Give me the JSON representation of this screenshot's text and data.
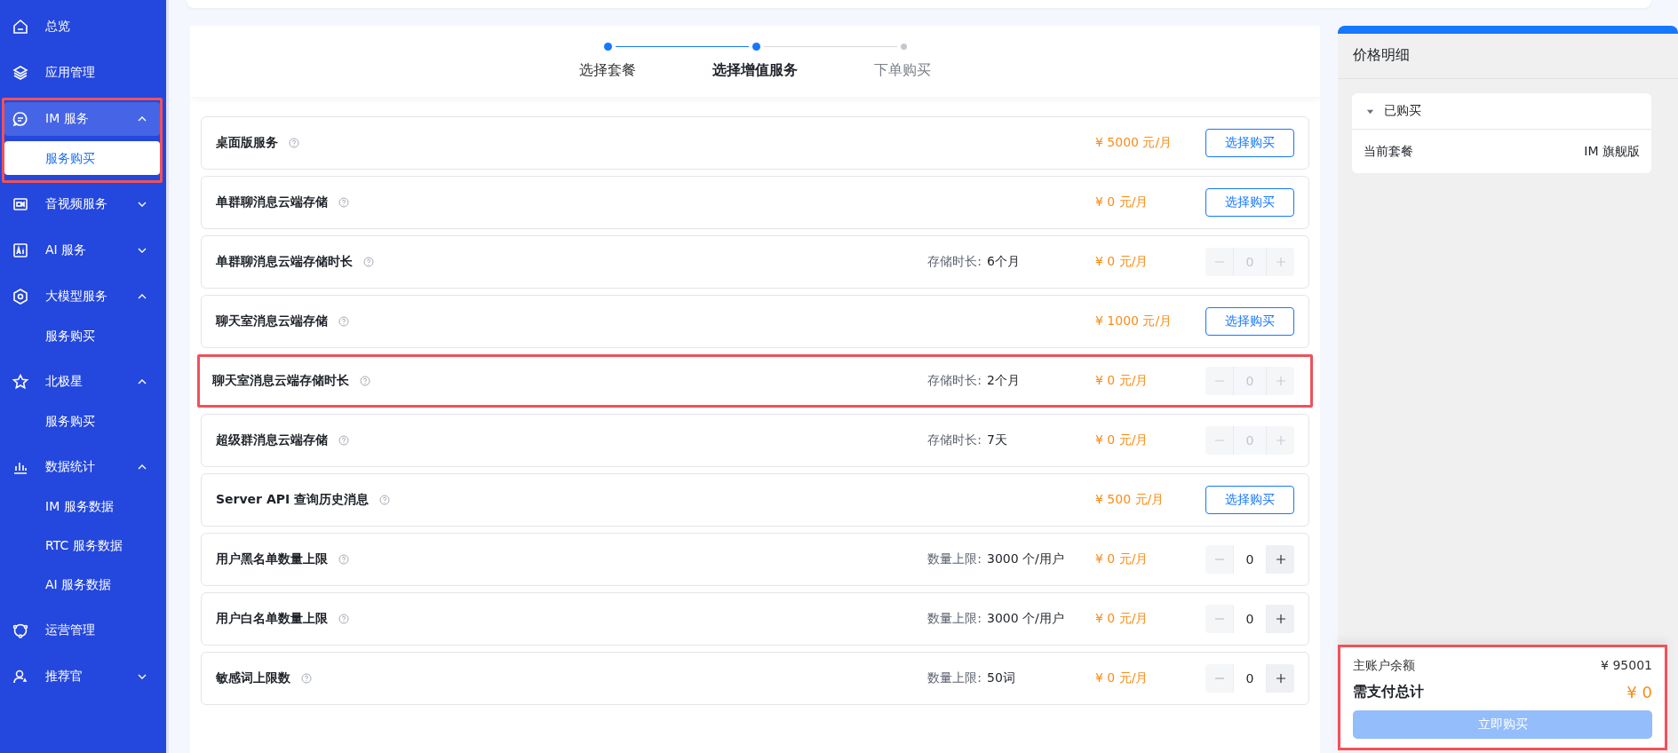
{
  "sidebar": {
    "items": [
      {
        "label": "总览",
        "selected": false,
        "highlighted": false
      },
      {
        "label": "应用管理",
        "selected": false,
        "highlighted": false
      },
      {
        "label": "IM 服务",
        "expanded": true,
        "selected": true,
        "highlighted": true,
        "children": [
          {
            "label": "服务购买",
            "selected": true
          }
        ]
      },
      {
        "label": "音视频服务",
        "expanded": false,
        "selected": false,
        "highlighted": false
      },
      {
        "label": "AI 服务",
        "expanded": false,
        "selected": false,
        "highlighted": false
      },
      {
        "label": "大模型服务",
        "expanded": true,
        "selected": false,
        "highlighted": false,
        "children": [
          {
            "label": "服务购买",
            "selected": false
          }
        ]
      },
      {
        "label": "北极星",
        "expanded": true,
        "selected": false,
        "highlighted": false,
        "children": [
          {
            "label": "服务购买",
            "selected": false
          }
        ]
      },
      {
        "label": "数据统计",
        "expanded": true,
        "selected": false,
        "highlighted": false,
        "children": [
          {
            "label": "IM 服务数据",
            "selected": false
          },
          {
            "label": "RTC 服务数据",
            "selected": false
          },
          {
            "label": "AI 服务数据",
            "selected": false
          }
        ]
      },
      {
        "label": "运营管理",
        "selected": false,
        "highlighted": false
      },
      {
        "label": "推荐官",
        "expanded": false,
        "selected": false,
        "highlighted": false
      }
    ]
  },
  "steps": [
    {
      "label": "选择套餐",
      "selected": false
    },
    {
      "label": "选择增值服务",
      "selected": true
    },
    {
      "label": "下单购买",
      "selected": false
    }
  ],
  "services": [
    {
      "name": "桌面版服务",
      "kind": "button",
      "price": "¥ 5000 元/月",
      "action": "选择购买",
      "highlighted": false
    },
    {
      "name": "单群聊消息云端存储",
      "kind": "button",
      "price": "¥ 0 元/月",
      "action": "选择购买",
      "highlighted": false
    },
    {
      "name": "单群聊消息云端存储时长",
      "kind": "stepper",
      "detail_label": "存储时长:",
      "detail_value": "6个月",
      "price": "¥ 0 元/月",
      "quantity": "0",
      "disabled": true,
      "highlighted": false
    },
    {
      "name": "聊天室消息云端存储",
      "kind": "button",
      "price": "¥ 1000 元/月",
      "action": "选择购买",
      "highlighted": false
    },
    {
      "name": "聊天室消息云端存储时长",
      "kind": "stepper",
      "detail_label": "存储时长:",
      "detail_value": "2个月",
      "price": "¥ 0 元/月",
      "quantity": "0",
      "disabled": true,
      "highlighted": true
    },
    {
      "name": "超级群消息云端存储",
      "kind": "stepper",
      "detail_label": "存储时长:",
      "detail_value": "7天",
      "price": "¥ 0 元/月",
      "quantity": "0",
      "disabled": true,
      "highlighted": false
    },
    {
      "name": "Server API 查询历史消息",
      "kind": "button",
      "price": "¥ 500 元/月",
      "action": "选择购买",
      "highlighted": false
    },
    {
      "name": "用户黑名单数量上限",
      "kind": "stepper",
      "detail_label": "数量上限:",
      "detail_value": "3000 个/用户",
      "price": "¥ 0 元/月",
      "quantity": "0",
      "disabled": false,
      "highlighted": false
    },
    {
      "name": "用户白名单数量上限",
      "kind": "stepper",
      "detail_label": "数量上限:",
      "detail_value": "3000 个/用户",
      "price": "¥ 0 元/月",
      "quantity": "0",
      "disabled": false,
      "highlighted": false
    },
    {
      "name": "敏感词上限数",
      "kind": "stepper",
      "detail_label": "数量上限:",
      "detail_value": "50词",
      "price": "¥ 0 元/月",
      "quantity": "0",
      "disabled": false,
      "highlighted": false
    }
  ],
  "price_panel": {
    "title": "价格明细",
    "section": {
      "title": "已购买",
      "expanded": true,
      "rows": [
        {
          "label": "当前套餐",
          "value": "IM 旗舰版"
        }
      ]
    },
    "summary": {
      "highlighted": true,
      "balance_label": "主账户余额",
      "balance": "¥ 95001",
      "total_label": "需支付总计",
      "total": "¥ 0",
      "buy_button": "立即购买",
      "buy_disabled": true
    }
  }
}
